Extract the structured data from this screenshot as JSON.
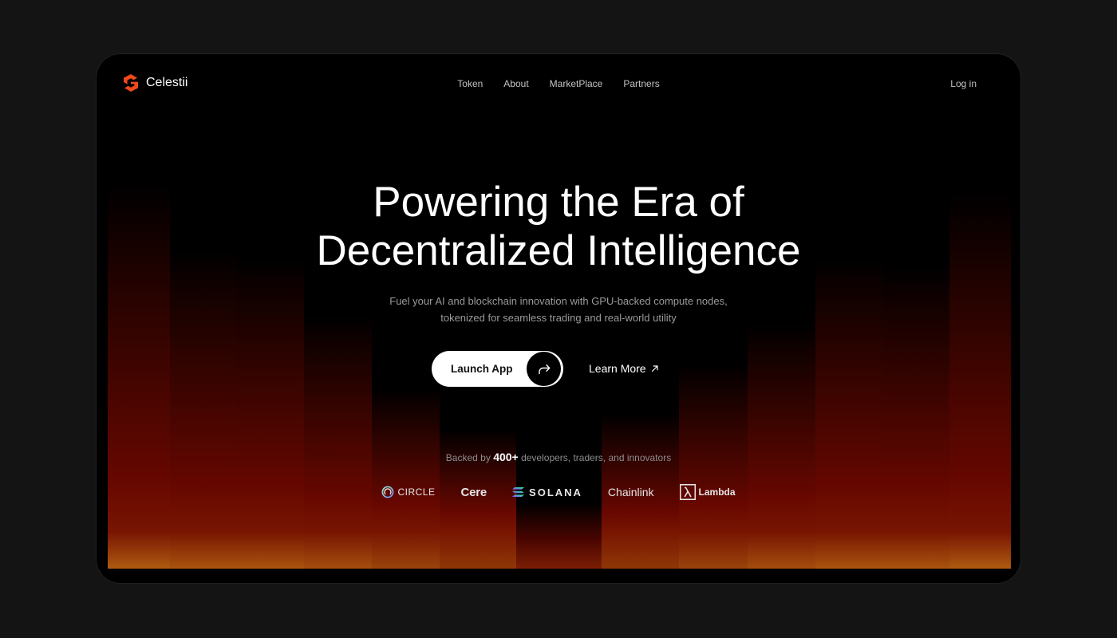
{
  "brand": {
    "name": "Celestii",
    "logo_icon": "celestii-logo-icon"
  },
  "nav": {
    "links": [
      "Token",
      "About",
      "MarketPlace",
      "Partners"
    ],
    "login": "Log in"
  },
  "hero": {
    "title_lines": [
      "Powering the Era of",
      "Decentralized Intelligence"
    ],
    "subtitle_lines": [
      "Fuel your AI and blockchain innovation with GPU-backed compute nodes,",
      "tokenized for seamless trading and real-world utility"
    ],
    "primary_cta": {
      "label": "Launch App",
      "icon": "share-forward-arrow-icon"
    },
    "secondary_cta": {
      "label": "Learn More",
      "icon": "arrow-up-right-icon"
    }
  },
  "social_proof": {
    "prefix": "Backed by",
    "count": "400+",
    "suffix": "developers, traders, and innovators"
  },
  "partners": [
    {
      "name": "CIRCLE",
      "icon": "circle-logo-icon"
    },
    {
      "name": "Cere"
    },
    {
      "name": "SOLANA",
      "icon": "solana-logo-icon"
    },
    {
      "name": "Chainlink"
    },
    {
      "name": "Lambda",
      "icon": "lambda-logo-icon"
    }
  ],
  "colors": {
    "page_background": "#141414",
    "card_background": "#000000",
    "brand_accent": "#F04A1C",
    "heading_text": "#FFFFFF",
    "muted_text": "#9A9A9A",
    "glow_red": "#660700",
    "glow_orange": "#AE5A10"
  }
}
